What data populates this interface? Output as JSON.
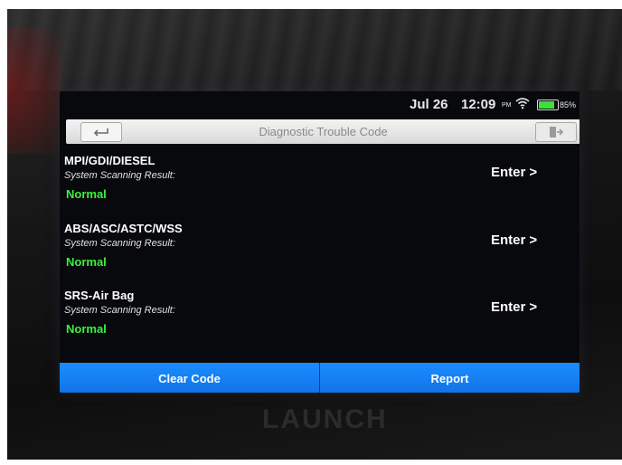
{
  "status_bar": {
    "date": "Jul 26",
    "time": "12:09",
    "ampm": "PM",
    "battery_percent": "85%",
    "battery_level": 0.85,
    "wifi_icon": "wifi-icon",
    "battery_icon": "battery-icon"
  },
  "header": {
    "title": "Diagnostic Trouble Code",
    "back_icon": "back-arrow-icon",
    "exit_icon": "exit-icon"
  },
  "systems": [
    {
      "name": "MPI/GDI/DIESEL",
      "subtitle": "System Scanning Result:",
      "status": "Normal",
      "action": "Enter",
      "arrow": ">"
    },
    {
      "name": "ABS/ASC/ASTC/WSS",
      "subtitle": "System Scanning Result:",
      "status": "Normal",
      "action": "Enter",
      "arrow": ">"
    },
    {
      "name": "SRS-Air Bag",
      "subtitle": "System Scanning Result:",
      "status": "Normal",
      "action": "Enter",
      "arrow": ">"
    }
  ],
  "footer": {
    "clear_code_label": "Clear Code",
    "report_label": "Report"
  },
  "brand": "LAUNCH",
  "colors": {
    "accent": "#1a8cff",
    "status_ok": "#3cf03c",
    "screen_bg": "#08090c"
  }
}
